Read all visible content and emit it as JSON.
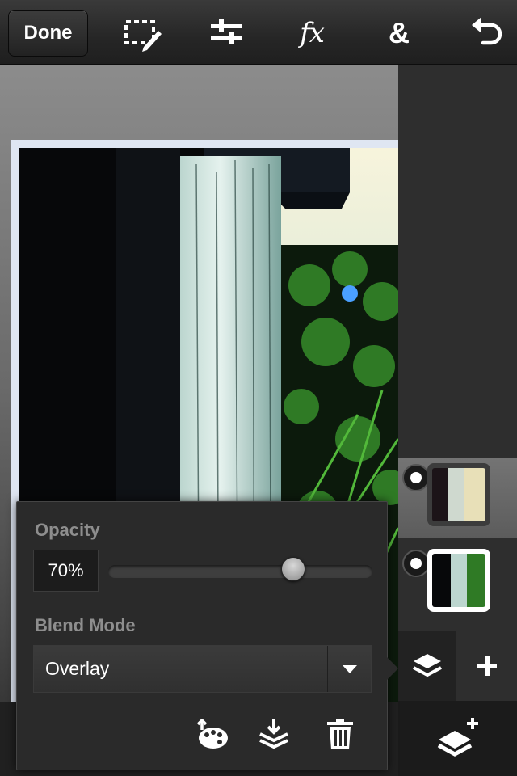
{
  "toolbar": {
    "done_label": "Done",
    "tools": [
      {
        "icon": "selection-edit-icon"
      },
      {
        "icon": "adjustments-icon"
      },
      {
        "icon": "effects-icon",
        "glyph": "fx"
      },
      {
        "icon": "blend-icon",
        "glyph": "&"
      },
      {
        "icon": "undo-icon"
      }
    ]
  },
  "canvas": {
    "photo_description_colors": [
      "#050608",
      "#dfe6f2"
    ]
  },
  "layers": [
    {
      "name": "layer-top",
      "selected": true
    },
    {
      "name": "layer-bottom",
      "selected": false
    }
  ],
  "properties": {
    "opacity_label": "Opacity",
    "opacity_value": "70%",
    "opacity_fraction": 0.7,
    "blend_label": "Blend Mode",
    "blend_value": "Overlay",
    "actions": [
      "color-palette-icon",
      "merge-down-icon",
      "trash-icon"
    ]
  },
  "colors": {
    "toolbar": "#262626",
    "panel": "#2a2a2a",
    "label": "#8e8e8e",
    "selected_layer": "#6a6a6a"
  }
}
